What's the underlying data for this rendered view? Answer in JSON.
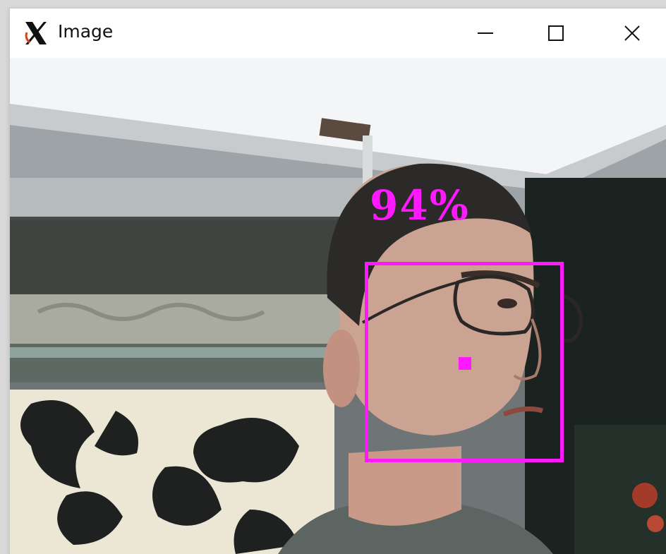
{
  "window": {
    "title": "Image",
    "controls": {
      "minimize": "minimize",
      "maximize": "maximize",
      "close": "close"
    }
  },
  "detection": {
    "confidence_label": "94%",
    "color": "#ff19ff"
  }
}
